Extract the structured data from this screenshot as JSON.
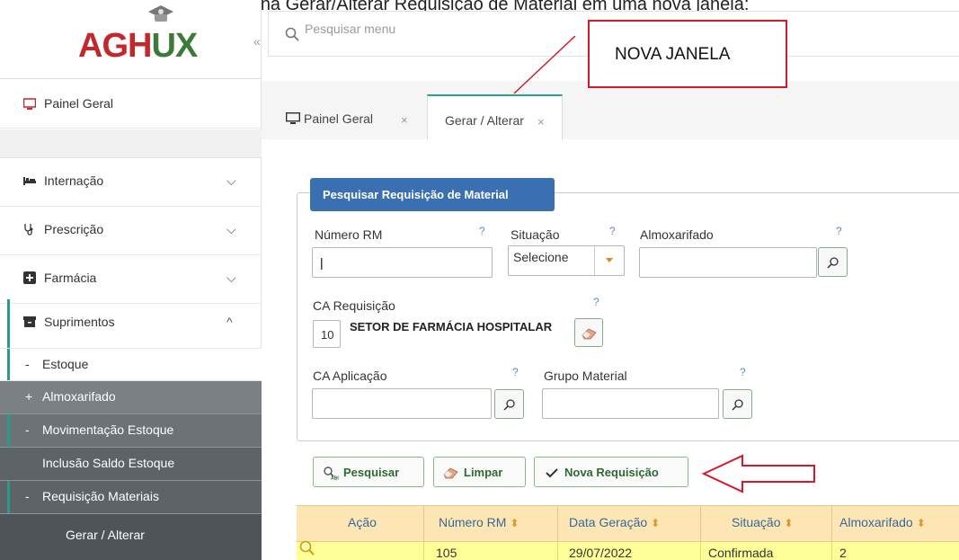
{
  "top_text": "página Gerar/Alterar Requisição de Material em uma nova janela:",
  "logo": {
    "text_part1": "AGH",
    "text_part2": "UX"
  },
  "topbar": {
    "search_placeholder": "Pesquisar menu"
  },
  "callout": {
    "label": "NOVA JANELA",
    "color": "#d6182a"
  },
  "sidebar": {
    "items": [
      {
        "label": "Painel Geral",
        "icon": "monitor-icon"
      },
      {
        "label": "Internação",
        "icon": "bed-icon",
        "expanded": false
      },
      {
        "label": "Prescrição",
        "icon": "stethoscope-icon",
        "expanded": false
      },
      {
        "label": "Farmácia",
        "icon": "plus-square-icon",
        "expanded": false
      },
      {
        "label": "Suprimentos",
        "icon": "archive-icon",
        "expanded": true
      }
    ],
    "sub_items": [
      {
        "prefix": "-",
        "label": "Estoque"
      },
      {
        "prefix": "+",
        "label": "Almoxarifado"
      },
      {
        "prefix": "-",
        "label": "Movimentação Estoque"
      },
      {
        "prefix": "",
        "label": "Inclusão Saldo Estoque"
      },
      {
        "prefix": "-",
        "label": "Requisição Materiais"
      },
      {
        "prefix": "",
        "label": "Gerar / Alterar"
      }
    ]
  },
  "tabs": [
    {
      "label": "Painel Geral",
      "close": "×",
      "icon": "monitor-icon"
    },
    {
      "label": "Gerar / Alterar",
      "close": "×",
      "active": true
    }
  ],
  "form": {
    "title": "Pesquisar Requisição de Material",
    "help": "?",
    "numero_rm": {
      "label": "Número RM",
      "value": "|"
    },
    "situacao": {
      "label": "Situação",
      "selected": "Selecione"
    },
    "almoxarifado": {
      "label": "Almoxarifado",
      "value": ""
    },
    "ca_requisicao": {
      "label": "CA Requisição",
      "code": "10",
      "name": "SETOR DE FARMÁCIA HOSPITALAR"
    },
    "ca_aplicacao": {
      "label": "CA Aplicação",
      "value": ""
    },
    "grupo_material": {
      "label": "Grupo Material",
      "value": ""
    }
  },
  "actions": {
    "search": "Pesquisar",
    "clear": "Limpar",
    "new": "Nova Requisição"
  },
  "table": {
    "headers": [
      "Ação",
      "Número RM",
      "Data Geração",
      "Situação",
      "Almoxarifado"
    ],
    "rows": [
      {
        "numero_rm": "105",
        "data_geracao": "29/07/2022",
        "situacao": "Confirmada",
        "almoxarifado": "2"
      }
    ]
  },
  "colors": {
    "accent": "#2a9a8a",
    "panel_title_bg": "#3a6fb2",
    "table_header_bg": "#fde6b4",
    "row_highlight": "#ffff99"
  }
}
